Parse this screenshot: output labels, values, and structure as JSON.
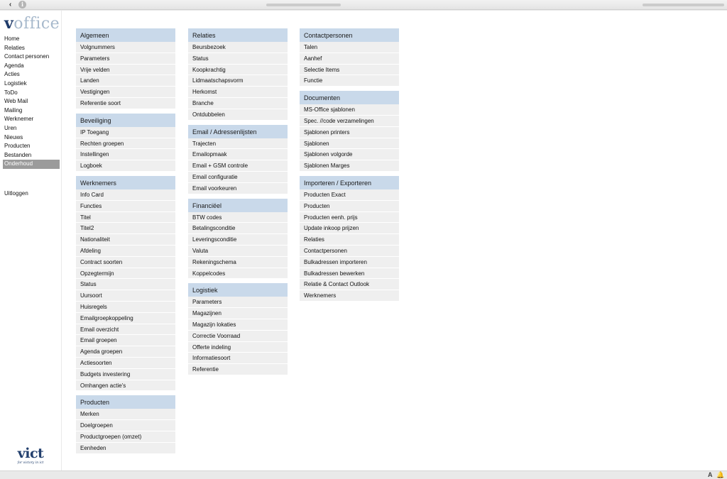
{
  "browser": {
    "back_icon": "chevron-left-icon",
    "back_glyph": "‹",
    "info_icon": "info-icon",
    "info_glyph": "i"
  },
  "sidebar": {
    "logo_initial": "v",
    "logo_rest": "office",
    "items": [
      {
        "label": "Home",
        "active": false
      },
      {
        "label": "Relaties",
        "active": false
      },
      {
        "label": "Contact personen",
        "active": false
      },
      {
        "label": "Agenda",
        "active": false
      },
      {
        "label": "Acties",
        "active": false
      },
      {
        "label": "Logistiek",
        "active": false
      },
      {
        "label": "ToDo",
        "active": false
      },
      {
        "label": "Web Mail",
        "active": false
      },
      {
        "label": "Mailing",
        "active": false
      },
      {
        "label": "Werknemer",
        "active": false
      },
      {
        "label": "Uren",
        "active": false
      },
      {
        "label": "Nieuws",
        "active": false
      },
      {
        "label": "Producten",
        "active": false
      },
      {
        "label": "Bestanden",
        "active": false
      },
      {
        "label": "Onderhoud",
        "active": true
      }
    ],
    "logout": "Uitloggen",
    "footer_logo": "vict",
    "footer_tagline": "for victory in ict"
  },
  "columns": [
    {
      "panels": [
        {
          "title": "Algemeen",
          "items": [
            "Volgnummers",
            "Parameters",
            "Vrije velden",
            "Landen",
            "Vestigingen",
            "Referentie soort"
          ]
        },
        {
          "title": "Beveiliging",
          "items": [
            "IP Toegang",
            "Rechten groepen",
            "Instellingen",
            "Logboek"
          ]
        },
        {
          "title": "Werknemers",
          "items": [
            "Info Card",
            "Functies",
            "Titel",
            "Titel2",
            "Nationaliteit",
            "Afdeling",
            "Contract soorten",
            "Opzegtermijn",
            "Status",
            "Uursoort",
            "Huisregels",
            "Emailgroepkoppeling",
            "Email overzicht",
            "Email groepen",
            "Agenda groepen",
            "Actiesoorten",
            "Budgets investering",
            "Omhangen actie's"
          ]
        },
        {
          "title": "Producten",
          "items": [
            "Merken",
            "Doelgroepen",
            "Productgroepen (omzet)",
            "Eenheden"
          ]
        }
      ]
    },
    {
      "panels": [
        {
          "title": "Relaties",
          "items": [
            "Beursbezoek",
            "Status",
            "Koopkrachtig",
            "Lidmaatschapsvorm",
            "Herkomst",
            "Branche",
            "Ontdubbelen"
          ]
        },
        {
          "title": "Email / Adressenlijsten",
          "items": [
            "Trajecten",
            "Emailopmaak",
            "Email + GSM controle",
            "Email configuratie",
            "Email voorkeuren"
          ]
        },
        {
          "title": "Financiëel",
          "items": [
            "BTW codes",
            "Betalingsconditie",
            "Leveringsconditie",
            "Valuta",
            "Rekeningschema",
            "Koppelcodes"
          ]
        },
        {
          "title": "Logistiek",
          "items": [
            "Parameters",
            "Magazijnen",
            "Magazijn lokaties",
            "Correctie Voorraad",
            "Offerte indeling",
            "Informatiesoort",
            "Referentie"
          ]
        }
      ]
    },
    {
      "panels": [
        {
          "title": "Contactpersonen",
          "items": [
            "Talen",
            "Aanhef",
            "Selectie Items",
            "Functie"
          ]
        },
        {
          "title": "Documenten",
          "items": [
            "MS-Office sjablonen",
            "Spec. //code verzamelingen",
            "Sjablonen printers",
            "Sjablonen",
            "Sjablonen volgorde",
            "Sjablonen Marges"
          ]
        },
        {
          "title": "Importeren / Exporteren",
          "items": [
            "Producten Exact",
            "Producten",
            "Producten eenh. prijs",
            "Update inkoop prijzen",
            "Relaties",
            "Contactpersonen",
            "Bulkadressen importeren",
            "Bulkadressen bewerken",
            "Relatie & Contact Outlook",
            "Werknemers"
          ]
        }
      ]
    }
  ],
  "statusbar": {
    "font_icon": "font-size-icon",
    "font_glyph": "A",
    "bell_icon": "bell-icon",
    "bell_glyph": "🔔"
  }
}
